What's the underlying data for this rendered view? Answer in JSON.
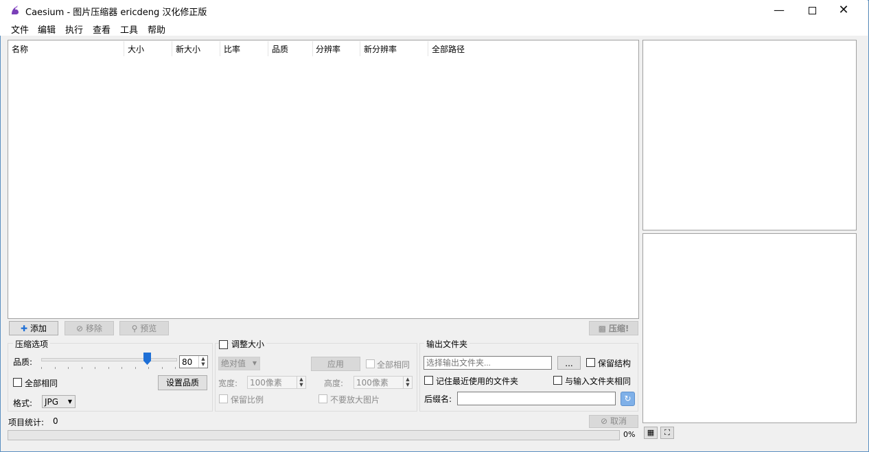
{
  "window": {
    "title": "Caesium - 图片压缩器  ericdeng 汉化修正版"
  },
  "menu": [
    "文件",
    "编辑",
    "执行",
    "查看",
    "工具",
    "帮助"
  ],
  "table": {
    "columns": [
      "名称",
      "大小",
      "新大小",
      "比率",
      "品质",
      "分辨率",
      "新分辨率",
      "全部路径"
    ]
  },
  "toolbar": {
    "add": "添加",
    "remove": "移除",
    "preview": "预览",
    "compress": "压缩!"
  },
  "compression": {
    "title": "压缩选项",
    "quality_label": "品质:",
    "quality_value": "80",
    "quality_fraction": 0.8,
    "all_same": "全部相同",
    "set_quality": "设置品质",
    "format_label": "格式:",
    "format_value": "JPG"
  },
  "resize": {
    "title": "调整大小",
    "mode": "绝对值",
    "apply": "应用",
    "all_same": "全部相同",
    "width_label": "宽度:",
    "width_value": "100像素",
    "height_label": "高度:",
    "height_value": "100像素",
    "keep_ratio": "保留比例",
    "no_enlarge": "不要放大图片"
  },
  "output": {
    "title": "输出文件夹",
    "folder_placeholder": "选择输出文件夹...",
    "browse": "...",
    "keep_structure": "保留结构",
    "remember_last": "记住最近使用的文件夹",
    "same_as_input": "与输入文件夹相同",
    "suffix_label": "后缀名:"
  },
  "status": {
    "items_label": "项目统计:",
    "items_count": "0",
    "cancel": "取消",
    "progress_text": "0%",
    "progress": 0
  },
  "colors": {
    "accent": "#1e6fd6",
    "app_icon": "#7a3fb8",
    "border": "#a0a0a0"
  }
}
